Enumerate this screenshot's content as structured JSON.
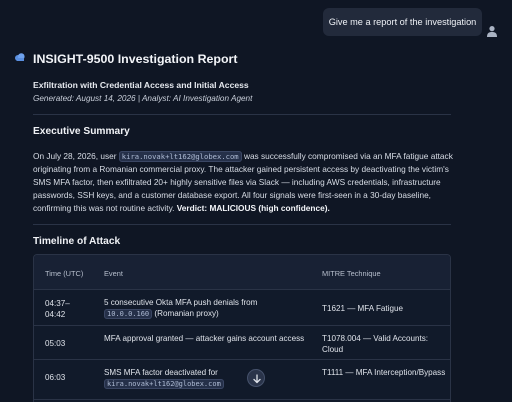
{
  "chat": {
    "user_message": "Give me a report of the investigation"
  },
  "report": {
    "title": "INSIGHT-9500 Investigation Report",
    "subtitle": "Exfiltration with Credential Access and Initial Access",
    "meta": "Generated: August 14, 2026 | Analyst: AI Investigation Agent",
    "executive_summary": {
      "heading": "Executive Summary",
      "text_1": "On July 28, 2026, user ",
      "user_email": "kira.novak+lt162@globex.com",
      "text_2": " was successfully compromised via an MFA fatigue attack originating from a Romanian commercial proxy. The attacker gained persistent access by deactivating the victim's SMS MFA factor, then exfiltrated 20+ highly sensitive files via Slack — including AWS credentials, infrastructure passwords, SSH keys, and a customer database export. All four signals were first-seen in a 30-day baseline, confirming this was not routine activity. ",
      "verdict": "Verdict: MALICIOUS (high confidence)."
    },
    "timeline": {
      "heading": "Timeline of Attack",
      "columns": [
        "Time (UTC)",
        "Event",
        "MITRE Technique"
      ],
      "rows": [
        {
          "time_line1": "04:37–",
          "time_line2": "04:42",
          "event_text": "5 consecutive Okta MFA push denials from",
          "event_code": "10.0.0.160",
          "event_suffix": " (Romanian proxy)",
          "mitre": "T1621 — MFA Fatigue"
        },
        {
          "time_line1": "05:03",
          "event_text": "MFA approval granted — attacker gains account access",
          "mitre": "T1078.004 — Valid Accounts: Cloud"
        },
        {
          "time_line1": "06:03",
          "event_text": "SMS MFA factor deactivated for",
          "event_code": "kira.novak+lt162@globex.com",
          "mitre": "T1111 — MFA Interception/Bypass"
        }
      ]
    }
  }
}
